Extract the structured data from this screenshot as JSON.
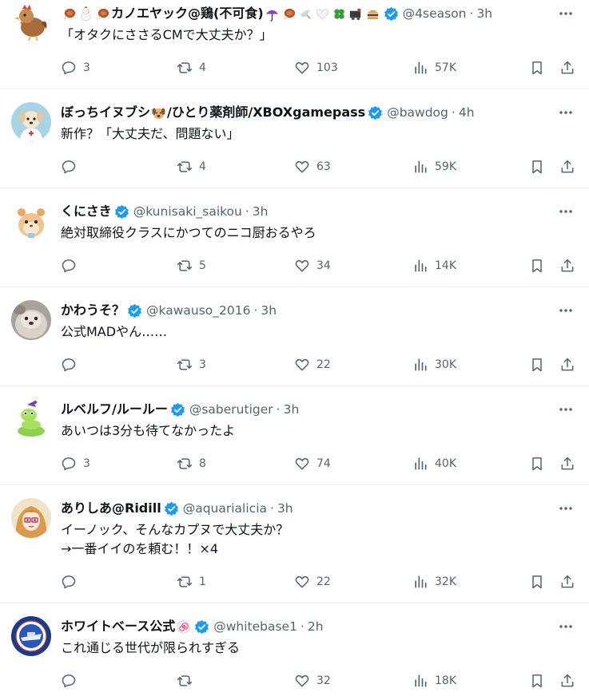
{
  "timeline": {
    "tweets": [
      {
        "display_name_parts": [
          "カノエヤック@鶏(不可食)"
        ],
        "handle": "@4season",
        "dot": "·",
        "time": "3h",
        "text_lines": [
          "「オタクにささるCMで大丈夫か？」"
        ],
        "reply_count": "3",
        "retweet_count": "4",
        "like_count": "103",
        "view_count": "57K"
      },
      {
        "display_name_parts": [
          "ぼっちイヌブシ",
          "/ひとり薬剤師/XBOXgamepass"
        ],
        "handle": "@bawdog",
        "dot": "·",
        "time": "4h",
        "text_lines": [
          "新作？「大丈夫だ、問題ない」"
        ],
        "reply_count": "",
        "retweet_count": "4",
        "like_count": "63",
        "view_count": "59K"
      },
      {
        "display_name_parts": [
          "くにさき"
        ],
        "handle": "@kunisaki_saikou",
        "dot": "·",
        "time": "3h",
        "text_lines": [
          "絶対取締役クラスにかつてのニコ厨おるやろ"
        ],
        "reply_count": "",
        "retweet_count": "5",
        "like_count": "34",
        "view_count": "14K"
      },
      {
        "display_name_parts": [
          "かわうそ？"
        ],
        "handle": "@kawauso_2016",
        "dot": "·",
        "time": "3h",
        "text_lines": [
          "公式MADやん……"
        ],
        "reply_count": "",
        "retweet_count": "3",
        "like_count": "22",
        "view_count": "30K"
      },
      {
        "display_name_parts": [
          "ルベルフ/ルールー"
        ],
        "handle": "@saberutiger",
        "dot": "·",
        "time": "3h",
        "text_lines": [
          "あいつは3分も待てなかったよ"
        ],
        "reply_count": "3",
        "retweet_count": "8",
        "like_count": "74",
        "view_count": "40K"
      },
      {
        "display_name_parts": [
          "ありしあ@Ridill"
        ],
        "handle": "@aquarialicia",
        "dot": "·",
        "time": "3h",
        "text_lines": [
          "イーノック、そんなカプヌで大丈夫か？",
          "→一番イイのを頼む！！×4"
        ],
        "reply_count": "",
        "retweet_count": "1",
        "like_count": "22",
        "view_count": "32K"
      },
      {
        "display_name_parts": [
          "ホワイトベース公式"
        ],
        "handle": "@whitebase1",
        "dot": "·",
        "time": "2h",
        "text_lines": [
          "これ通じる世代が限られすぎる"
        ],
        "reply_count": "",
        "retweet_count": "",
        "like_count": "32",
        "view_count": "18K"
      }
    ]
  },
  "icons": {
    "avatars": [
      "rooster-avatar",
      "doctor-dog-avatar",
      "hamster-avatar",
      "otter-photo-avatar",
      "snake-avatar",
      "anime-girl-avatar",
      "whitebase-logo-avatar"
    ],
    "actions": [
      "reply-icon",
      "retweet-icon",
      "like-icon",
      "views-icon",
      "bookmark-icon",
      "share-icon"
    ],
    "more": "more-icon",
    "verified": "verified-badge-icon"
  },
  "colors": {
    "text_primary": "#0f1419",
    "text_secondary": "#536471",
    "verified_blue": "#1d9bf0",
    "divider": "#eff3f4"
  }
}
